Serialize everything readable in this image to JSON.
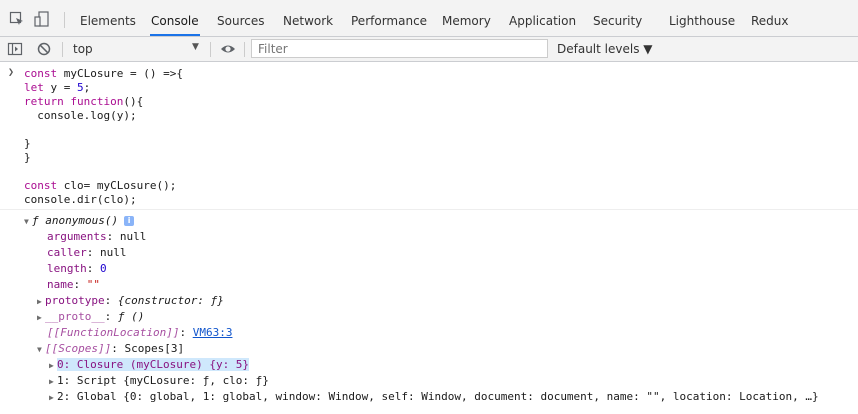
{
  "tabs": [
    {
      "label": "Elements"
    },
    {
      "label": "Console"
    },
    {
      "label": "Sources"
    },
    {
      "label": "Network"
    },
    {
      "label": "Performance"
    },
    {
      "label": "Memory"
    },
    {
      "label": "Application"
    },
    {
      "label": "Security"
    },
    {
      "label": "Lighthouse"
    },
    {
      "label": "Redux"
    }
  ],
  "active_tab": "Console",
  "toolbar": {
    "context": "top",
    "filter_placeholder": "Filter",
    "levels_label": "Default levels ▼"
  },
  "console": {
    "input_code": [
      "const myCLosure = () =>{",
      "let y = 5;",
      "return function(){",
      "  console.log(y);",
      "",
      "}",
      "}",
      "",
      "const clo= myCLosure();",
      "console.dir(clo);"
    ],
    "output": {
      "header": "ƒ anonymous()",
      "props": [
        {
          "key": "arguments",
          "value": "null"
        },
        {
          "key": "caller",
          "value": "null"
        },
        {
          "key": "length",
          "value": "0"
        },
        {
          "key": "name",
          "value": "\"\""
        }
      ],
      "prototype": {
        "key": "prototype",
        "value": "{constructor: ƒ}"
      },
      "proto": {
        "key": "__proto__",
        "value": "ƒ ()"
      },
      "function_location": {
        "key": "[[FunctionLocation]]",
        "value": "VM63:3"
      },
      "scopes": {
        "key": "[[Scopes]]",
        "value": "Scopes[3]"
      },
      "scope_items": [
        "0: Closure (myCLosure) {y: 5}",
        "1: Script {myCLosure: ƒ, clo: ƒ}",
        "2: Global {0: global, 1: global, window: Window, self: Window, document: document, name: \"\", location: Location, …}"
      ]
    }
  },
  "colors": {
    "accent": "#1a73e8",
    "keyword": "#aa0d91",
    "number": "#1c00cf",
    "string": "#c41a16",
    "property": "#881280",
    "link": "#1155cc",
    "highlight": "#cfe8fc"
  },
  "icons": [
    "inspect-element-icon",
    "device-toggle-icon",
    "sidebar-toggle-icon",
    "clear-console-icon",
    "eye-icon",
    "info-icon"
  ]
}
